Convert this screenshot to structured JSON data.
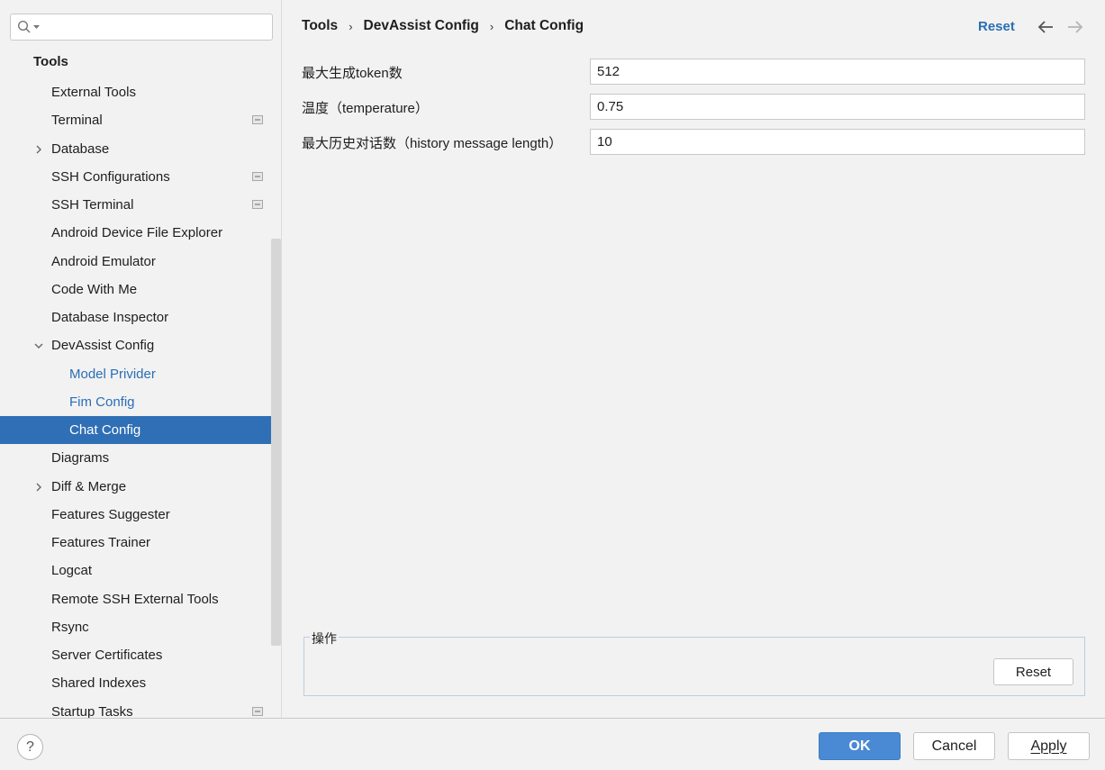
{
  "search": {
    "placeholder": ""
  },
  "sidebar": {
    "header": "Tools",
    "items": [
      {
        "label": "External Tools",
        "arrow": "",
        "project": false,
        "level": 1
      },
      {
        "label": "Terminal",
        "arrow": "",
        "project": true,
        "level": 1
      },
      {
        "label": "Database",
        "arrow": "right",
        "project": false,
        "level": 1
      },
      {
        "label": "SSH Configurations",
        "arrow": "",
        "project": true,
        "level": 1
      },
      {
        "label": "SSH Terminal",
        "arrow": "",
        "project": true,
        "level": 1
      },
      {
        "label": "Android Device File Explorer",
        "arrow": "",
        "project": false,
        "level": 1
      },
      {
        "label": "Android Emulator",
        "arrow": "",
        "project": false,
        "level": 1
      },
      {
        "label": "Code With Me",
        "arrow": "",
        "project": false,
        "level": 1
      },
      {
        "label": "Database Inspector",
        "arrow": "",
        "project": false,
        "level": 1
      },
      {
        "label": "DevAssist Config",
        "arrow": "down",
        "project": false,
        "level": 1
      },
      {
        "label": "Model Privider",
        "arrow": "",
        "project": false,
        "level": 2
      },
      {
        "label": "Fim Config",
        "arrow": "",
        "project": false,
        "level": 2
      },
      {
        "label": "Chat Config",
        "arrow": "",
        "project": false,
        "level": 2,
        "selected": true
      },
      {
        "label": "Diagrams",
        "arrow": "",
        "project": false,
        "level": 1
      },
      {
        "label": "Diff & Merge",
        "arrow": "right",
        "project": false,
        "level": 1
      },
      {
        "label": "Features Suggester",
        "arrow": "",
        "project": false,
        "level": 1
      },
      {
        "label": "Features Trainer",
        "arrow": "",
        "project": false,
        "level": 1
      },
      {
        "label": "Logcat",
        "arrow": "",
        "project": false,
        "level": 1
      },
      {
        "label": "Remote SSH External Tools",
        "arrow": "",
        "project": false,
        "level": 1
      },
      {
        "label": "Rsync",
        "arrow": "",
        "project": false,
        "level": 1
      },
      {
        "label": "Server Certificates",
        "arrow": "",
        "project": false,
        "level": 1
      },
      {
        "label": "Shared Indexes",
        "arrow": "",
        "project": false,
        "level": 1
      },
      {
        "label": "Startup Tasks",
        "arrow": "",
        "project": true,
        "level": 1
      }
    ]
  },
  "breadcrumb": {
    "parts": [
      "Tools",
      "DevAssist Config",
      "Chat Config"
    ],
    "separator": "›"
  },
  "header": {
    "reset_label": "Reset"
  },
  "form": {
    "fields": [
      {
        "label": "最大生成token数",
        "value": "512"
      },
      {
        "label": "温度（temperature）",
        "value": "0.75"
      },
      {
        "label": "最大历史对话数（history message length）",
        "value": "10"
      }
    ]
  },
  "actions": {
    "title": "操作",
    "reset_label": "Reset"
  },
  "footer": {
    "help_label": "?",
    "ok_label": "OK",
    "cancel_label": "Cancel",
    "apply_label": "Apply"
  },
  "colors": {
    "accent": "#2f6fb5",
    "link": "#2b6eb5",
    "ok_button": "#4a8ad4"
  }
}
